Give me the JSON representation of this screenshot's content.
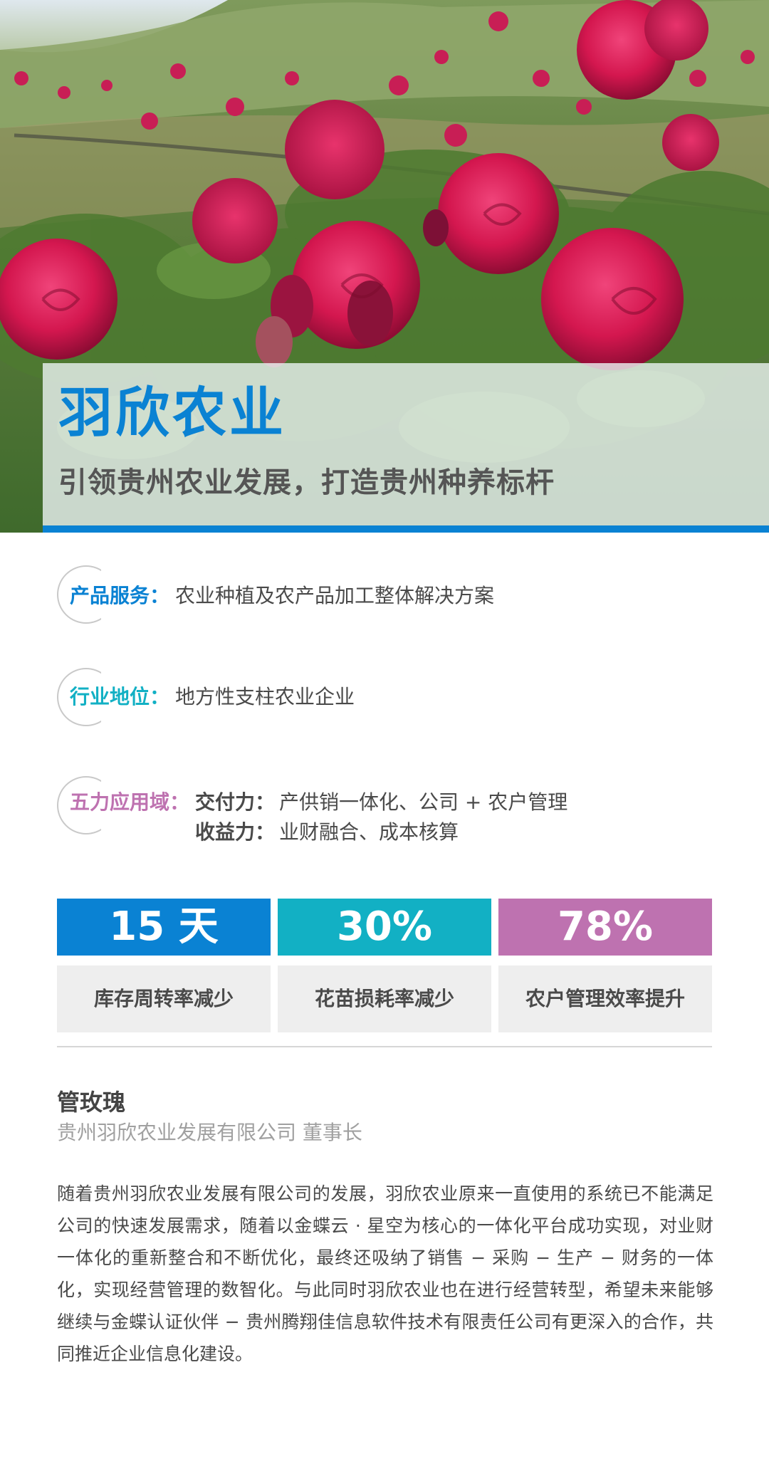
{
  "hero": {
    "title": "羽欣农业",
    "subtitle": "引领贵州农业发展，打造贵州种养标杆"
  },
  "colors": {
    "blue": "#0a82d3",
    "teal": "#12b0c4",
    "purple": "#be72b0",
    "stat_bg": "#eeeeee"
  },
  "info": {
    "product": {
      "label": "产品服务：",
      "value": "农业种植及农产品加工整体解决方案"
    },
    "position": {
      "label": "行业地位：",
      "value": "地方性支柱农业企业"
    },
    "domains": {
      "label": "五力应用域：",
      "items": [
        {
          "label": "交付力：",
          "value": "产供销一体化、公司 + 农户管理"
        },
        {
          "label": "收益力：",
          "value": "业财融合、成本核算"
        }
      ]
    }
  },
  "stats": [
    {
      "value": "15 天",
      "label": "库存周转率减少"
    },
    {
      "value": "30%",
      "label": "花苗损耗率减少"
    },
    {
      "value": "78%",
      "label": "农户管理效率提升"
    }
  ],
  "person": {
    "name": "管玫瑰",
    "title": "贵州羽欣农业发展有限公司 董事长"
  },
  "body": "随着贵州羽欣农业发展有限公司的发展，羽欣农业原来一直使用的系统已不能满足公司的快速发展需求，随着以金蝶云 · 星空为核心的一体化平台成功实现，对业财一体化的重新整合和不断优化，最终还吸纳了销售 − 采购 − 生产 − 财务的一体化，实现经营管理的数智化。与此同时羽欣农业也在进行经营转型，希望未来能够继续与金蝶认证伙伴 − 贵州腾翔佳信息软件技术有限责任公司有更深入的合作，共同推近企业信息化建设。"
}
